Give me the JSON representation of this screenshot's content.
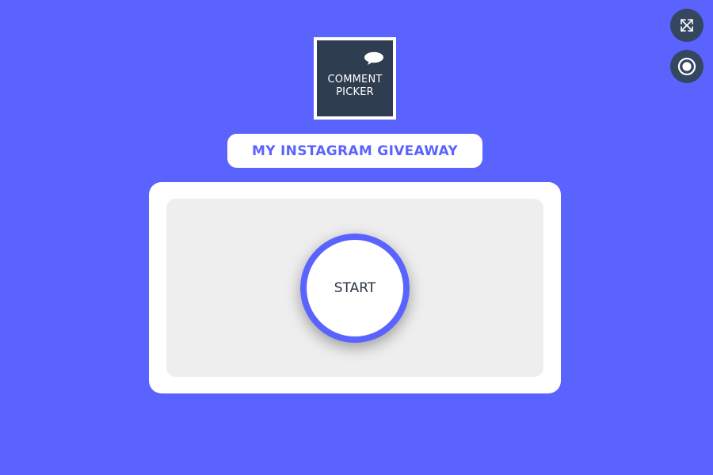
{
  "colors": {
    "background": "#5b63ff",
    "accent": "#5b63ff",
    "control_bg": "#34475e",
    "logo_bg": "#2f3d50",
    "card_inner": "#eeeeee",
    "start_text": "#2a3442"
  },
  "controls": {
    "expand_icon": "fullscreen-expand-icon",
    "record_icon": "record-icon"
  },
  "logo": {
    "line1": "COMMENT",
    "line2": "PICKER",
    "bubble_icon": "speech-bubble-icon"
  },
  "title": "MY INSTAGRAM GIVEAWAY",
  "start_button": {
    "label": "START"
  }
}
